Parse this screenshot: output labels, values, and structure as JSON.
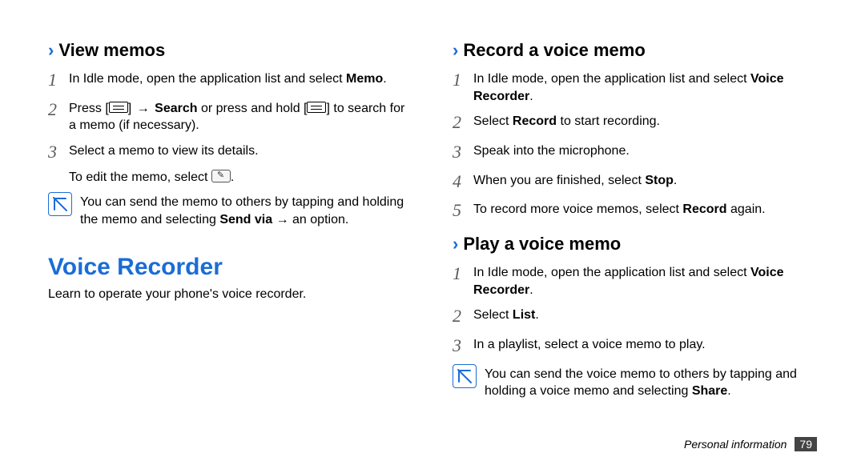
{
  "left": {
    "sub_view_memos": "View memos",
    "step1_a": "In Idle mode, open the application list and select ",
    "step1_b": "Memo",
    "step1_c": ".",
    "step2_a": "Press [",
    "step2_b": "] ",
    "step2_arrow": "→",
    "step2_c": " ",
    "step2_search": "Search",
    "step2_d": " or press and hold [",
    "step2_e": "] to search for a memo (if necessary).",
    "step3": "Select a memo to view its details.",
    "step3_sub_a": "To edit the memo, select ",
    "step3_sub_b": ".",
    "note_a": "You can send the memo to others by tapping and holding the memo and selecting ",
    "note_b": "Send via",
    "note_arrow": " → ",
    "note_c": "an option.",
    "main_heading": "Voice Recorder",
    "intro": "Learn to operate your phone's voice recorder."
  },
  "right": {
    "sub_record": "Record a voice memo",
    "r1_a": "In Idle mode, open the application list and select ",
    "r1_b": "Voice Recorder",
    "r1_c": ".",
    "r2_a": "Select ",
    "r2_b": "Record",
    "r2_c": " to start recording.",
    "r3": "Speak into the microphone.",
    "r4_a": "When you are finished, select ",
    "r4_b": "Stop",
    "r4_c": ".",
    "r5_a": "To record more voice memos, select ",
    "r5_b": "Record",
    "r5_c": " again.",
    "sub_play": "Play a voice memo",
    "p1_a": "In Idle mode, open the application list and select ",
    "p1_b": "Voice Recorder",
    "p1_c": ".",
    "p2_a": "Select ",
    "p2_b": "List",
    "p2_c": ".",
    "p3": "In a playlist, select a voice memo to play.",
    "pnote_a": "You can send the voice memo to others by tapping and holding a voice memo and selecting ",
    "pnote_b": "Share",
    "pnote_c": "."
  },
  "footer": {
    "section": "Personal information",
    "page": "79"
  },
  "nums": {
    "n1": "1",
    "n2": "2",
    "n3": "3",
    "n4": "4",
    "n5": "5"
  },
  "chevron": "›"
}
